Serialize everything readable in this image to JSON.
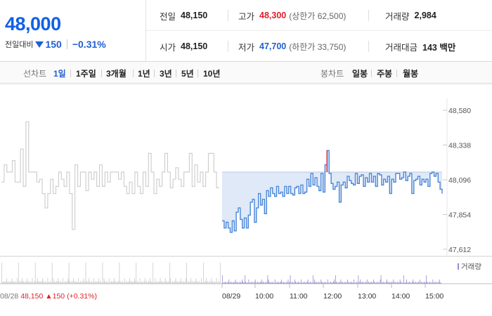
{
  "summary": {
    "price": "48,000",
    "change_label": "전일대비",
    "change_amount": "150",
    "change_percent": "−0.31%",
    "prev_close": {
      "label": "전일",
      "value": "48,150"
    },
    "high": {
      "label": "고가",
      "value": "48,300",
      "limit_label": "(상한가 62,500)"
    },
    "volume": {
      "label": "거래량",
      "value": "2,984"
    },
    "open": {
      "label": "시가",
      "value": "48,150"
    },
    "low": {
      "label": "저가",
      "value": "47,700",
      "limit_label": "(하한가 33,750)"
    },
    "trade_value": {
      "label": "거래대금",
      "value": "143 백만"
    }
  },
  "tabs": {
    "line_title": "선차트",
    "line_periods": [
      "1일",
      "1주일",
      "3개월",
      "1년",
      "3년",
      "5년",
      "10년"
    ],
    "active_line_period": "1일",
    "candle_title": "봉차트",
    "candle_periods": [
      "일봉",
      "주봉",
      "월봉"
    ]
  },
  "colors": {
    "up": "#e0202a",
    "down": "#1f5fd1",
    "line_today": "#4a86d8",
    "fill_today": "#dfe9f8",
    "line_prev": "#cfcfcf",
    "volume_today": "#9a8ad0",
    "volume_prev": "#cccccc"
  },
  "chart_data": {
    "type": "line",
    "title": "",
    "y_ticks": [
      "48,580",
      "48,338",
      "48,096",
      "47,854",
      "47,612"
    ],
    "ylim": [
      47612,
      48580
    ],
    "x_ticks": [
      "08/28",
      "08/29",
      "10:00",
      "11:00",
      "12:00",
      "13:00",
      "14:00",
      "15:00"
    ],
    "reference_price": 48150,
    "volume_legend": "거래량",
    "prev_day_info": {
      "date": "08/28",
      "price": "48,150",
      "change": "▲150 (+0.31%)"
    },
    "series": [
      {
        "values": [
          48080,
          48200,
          48150,
          48150,
          48230,
          48080,
          48080,
          48310,
          48050,
          48500,
          48150,
          48150,
          48150,
          48080,
          48100,
          48000,
          47900,
          48000,
          48100,
          48000,
          48050,
          48150,
          48100,
          48050,
          48150,
          48000,
          47750,
          48200,
          48050,
          48150,
          48150,
          48020,
          48150,
          48100,
          48150,
          48050,
          48200,
          48050,
          48150,
          48080,
          48150,
          48150,
          48150,
          48100,
          48150,
          48050,
          48000,
          48080,
          48000,
          48150,
          48050,
          48000,
          48150,
          48050,
          48280,
          48150,
          48000,
          48100,
          48050,
          48150,
          48280,
          48150,
          48040,
          48100,
          48180,
          48100,
          48050,
          48150,
          48150,
          48280,
          48050,
          48200,
          48080,
          48150,
          48050,
          48150,
          48280,
          48280,
          48150,
          48040,
          48040
        ]
      },
      {
        "values": [
          47810,
          47760,
          47800,
          47760,
          47730,
          47810,
          47740,
          47870,
          47900,
          47820,
          47760,
          47830,
          47760,
          47850,
          47940,
          47960,
          47800,
          47900,
          48000,
          47920,
          47960,
          47860,
          48020,
          47980,
          48040,
          48000,
          47980,
          48050,
          48000,
          48010,
          47980,
          48050,
          48000,
          48050,
          48000,
          47990,
          48040,
          48050,
          48000,
          48060,
          48000,
          48010,
          48100,
          48050,
          48140,
          48060,
          48110,
          48050,
          48020,
          48140,
          48010,
          48200,
          48300,
          48140,
          48070,
          48030,
          48050,
          48080,
          47940,
          48060,
          48080,
          48040,
          48120,
          48090,
          48070,
          48060,
          48140,
          48070,
          48120,
          48130,
          48050,
          48110,
          48080,
          48140,
          48080,
          48120,
          48050,
          48140,
          48130,
          48060,
          48100,
          48080,
          48120,
          48000,
          48100,
          48080,
          48140,
          48140,
          48100,
          48110,
          48150,
          48090,
          48120,
          48140,
          48000,
          48090,
          48100,
          48120,
          48060,
          48100,
          48080,
          48100,
          48050,
          48140,
          48150,
          48120,
          48140,
          48080,
          48030,
          48000
        ]
      }
    ]
  }
}
